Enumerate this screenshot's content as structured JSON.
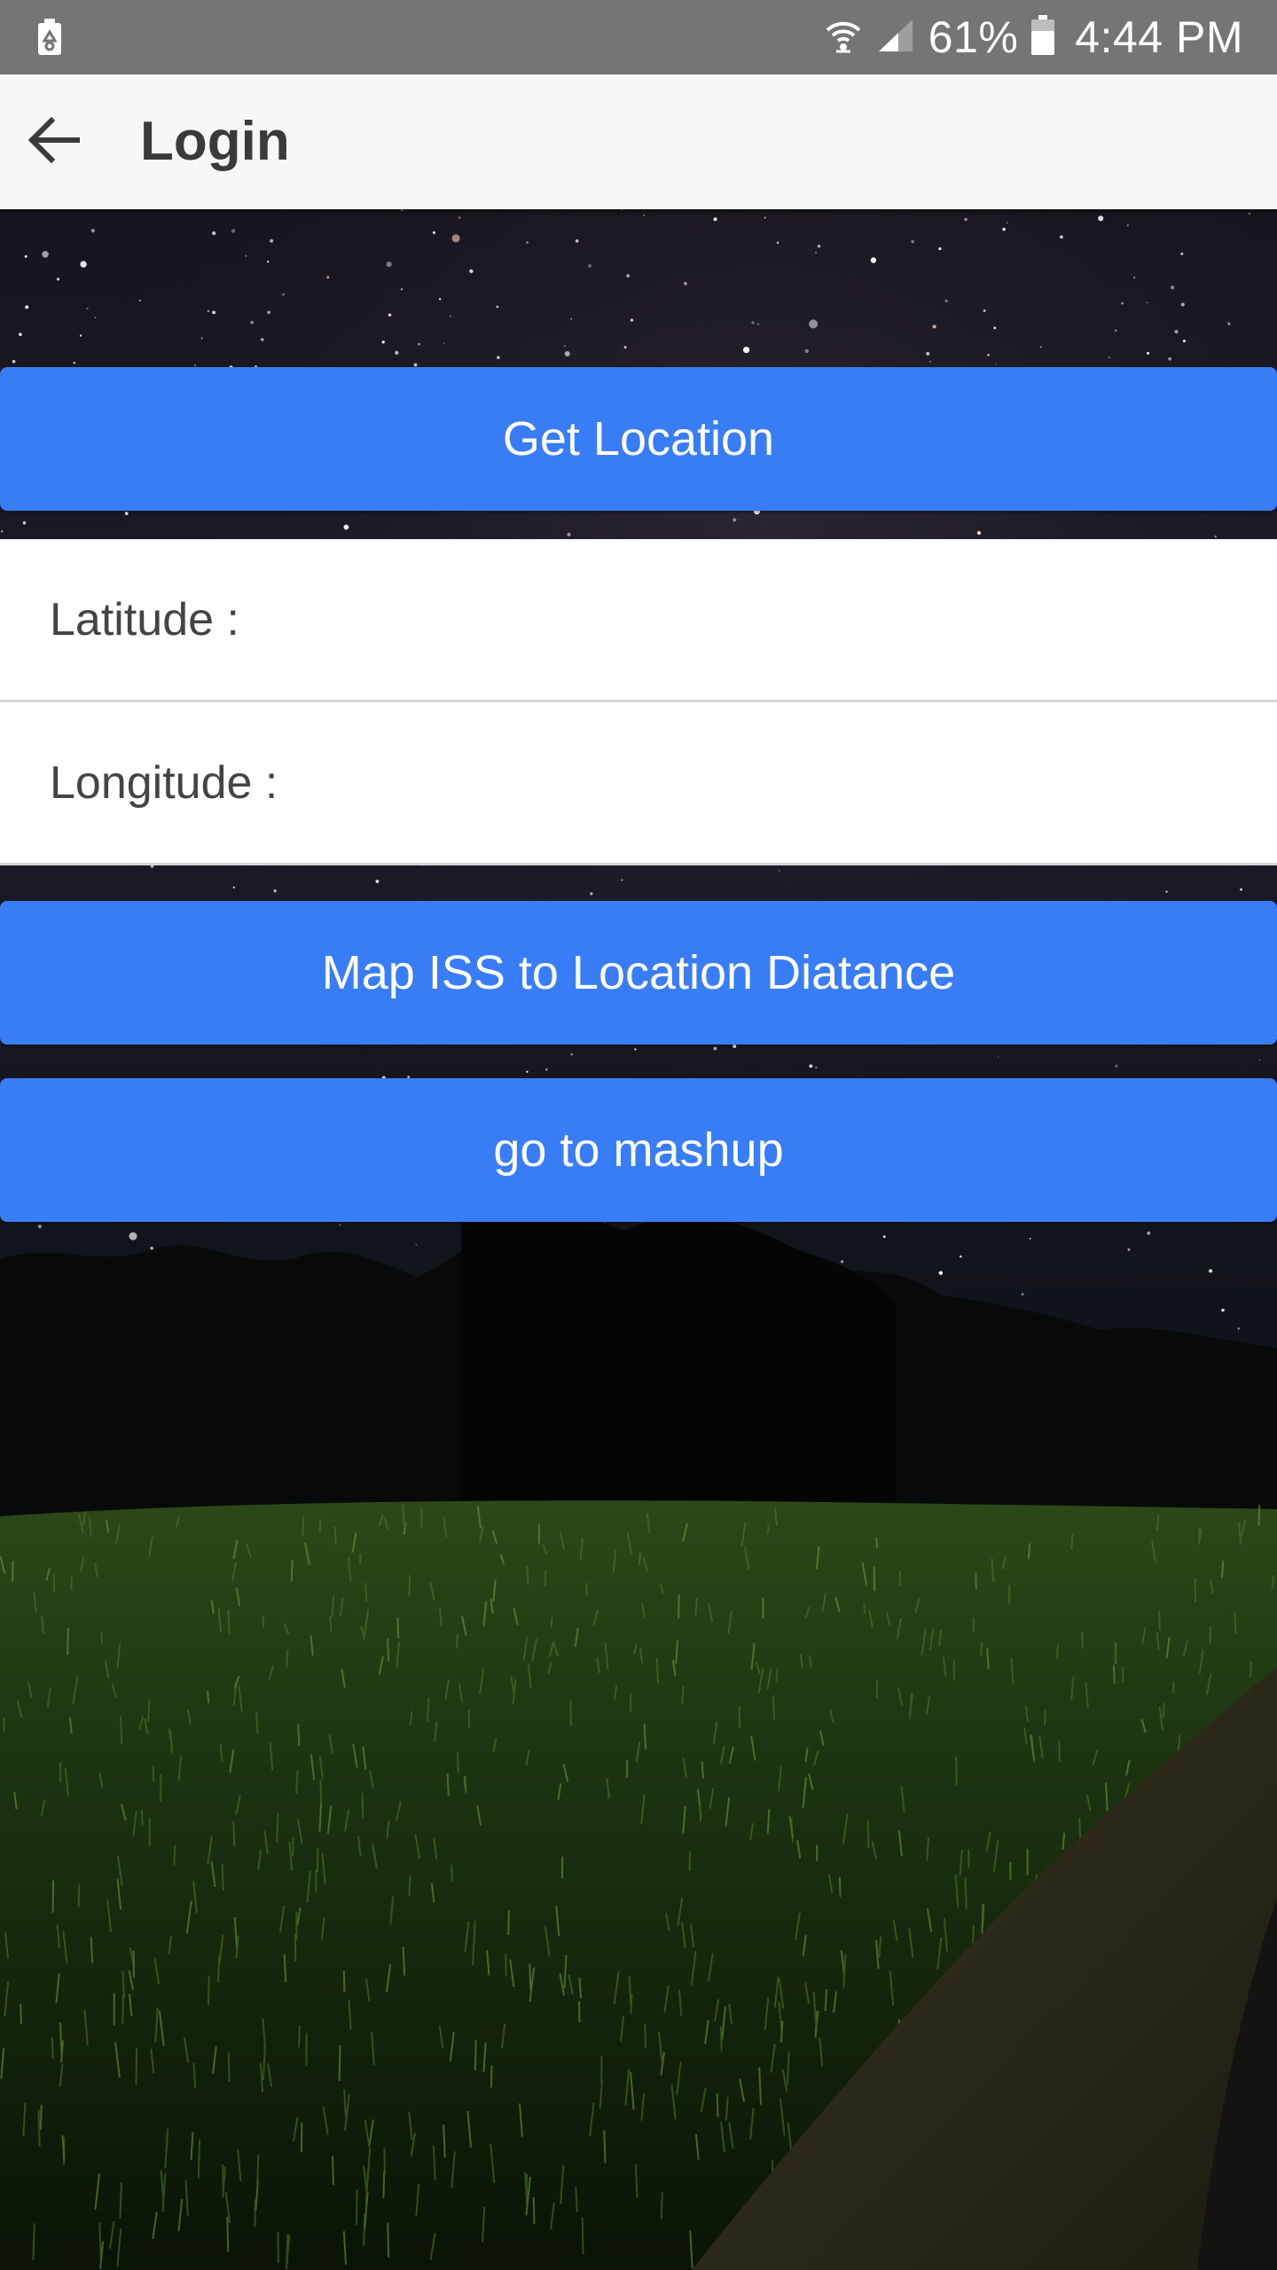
{
  "status_bar": {
    "battery_percent": "61%",
    "time": "4:44 PM",
    "icons": [
      "recycle-icon",
      "wifi-icon",
      "cellular-signal-icon",
      "battery-icon"
    ]
  },
  "app_bar": {
    "title": "Login",
    "back_icon": "arrow-back-icon"
  },
  "main": {
    "get_location_label": "Get Location",
    "latitude": {
      "label": "Latitude :",
      "value": ""
    },
    "longitude": {
      "label": "Longitude :",
      "value": ""
    },
    "map_iss_label": "Map ISS to Location Diatance",
    "mashup_label": "go to mashup"
  },
  "colors": {
    "status_bar": "#757575",
    "app_bar": "#f7f7f7",
    "button": "#387df5",
    "button_text": "#ffffff",
    "row_bg": "#ffffff",
    "row_text": "#444444"
  }
}
